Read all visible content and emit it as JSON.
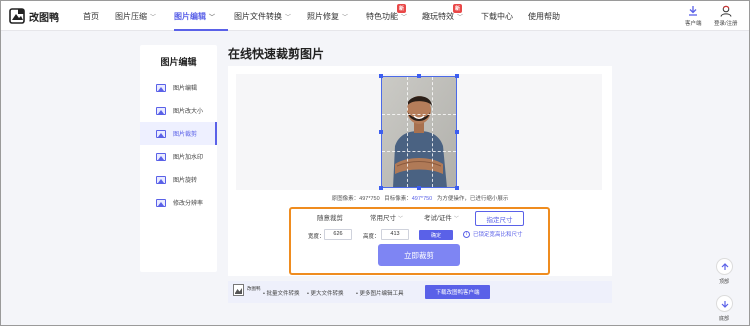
{
  "brand": {
    "name": "改图鸭"
  },
  "nav": [
    {
      "label": "首页",
      "caret": false,
      "active": false
    },
    {
      "label": "图片压缩",
      "caret": true,
      "active": false
    },
    {
      "label": "图片编辑",
      "caret": true,
      "active": true
    },
    {
      "label": "图片文件转换",
      "caret": true,
      "active": false
    },
    {
      "label": "照片修复",
      "caret": true,
      "active": false
    },
    {
      "label": "特色功能",
      "caret": true,
      "active": false,
      "badge": "新"
    },
    {
      "label": "趣玩特效",
      "caret": true,
      "active": false,
      "badge": "新"
    },
    {
      "label": "下载中心",
      "caret": false,
      "active": false
    },
    {
      "label": "使用帮助",
      "caret": false,
      "active": false
    }
  ],
  "header_right": {
    "client_label": "客户端",
    "login_label": "登录/注册"
  },
  "sidebar": {
    "title": "图片编辑",
    "items": [
      {
        "label": "图片编辑",
        "active": false
      },
      {
        "label": "图片改大小",
        "active": false
      },
      {
        "label": "图片裁剪",
        "active": true
      },
      {
        "label": "图片加水印",
        "active": false
      },
      {
        "label": "图片旋转",
        "active": false
      },
      {
        "label": "修改分辨率",
        "active": false
      }
    ]
  },
  "main": {
    "title": "在线快速裁剪图片",
    "info": {
      "orig_label": "原图像素：",
      "orig_value": "497*750",
      "target_label": "目标像素：",
      "target_value": "497*750",
      "note": "为方便操作，已进行缩小展示"
    },
    "options": {
      "free": "随意裁剪",
      "common": "常用尺寸",
      "exam": "考试/证件",
      "fixed": "指定尺寸"
    },
    "width_label": "宽度：",
    "width_value": "626",
    "height_label": "高度：",
    "height_value": "413",
    "confirm": "确定",
    "tip": "已锁定宽高比和尺寸",
    "crop_button": "立即裁剪"
  },
  "bottom_bar": {
    "mini_label": "改图鸭",
    "items": [
      "批量文件转换",
      "更大文件转换",
      "更多图片编辑工具"
    ],
    "download_button": "下载改图鸭客户端"
  },
  "float": {
    "top_label": "顶部",
    "bottom_label": "底部"
  },
  "colors": {
    "accent": "#5a61e8",
    "highlight_border": "#ef8c1f",
    "badge": "#e94848"
  }
}
